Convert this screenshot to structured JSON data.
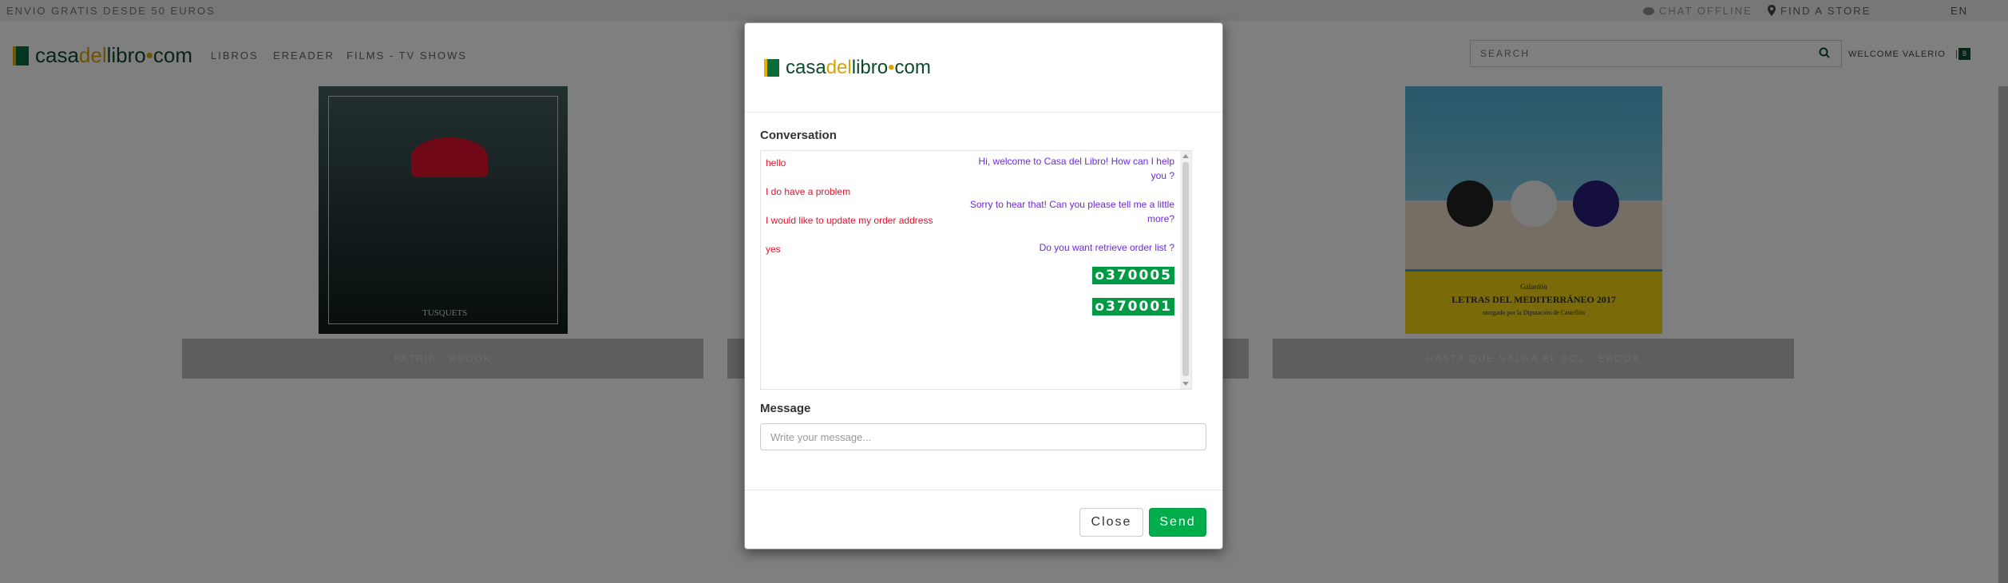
{
  "topbar": {
    "promo": "ENVIO GRATIS DESDE 50 EUROS",
    "chat_status": "CHAT OFFLINE",
    "find_store": "FIND A STORE",
    "language": "EN"
  },
  "header": {
    "logo": {
      "part1": "casa",
      "part2": "del",
      "part3": "libro",
      "part4": "•",
      "part5": "com"
    },
    "nav": [
      "LIBROS",
      "EREADER",
      "FILMS - TV SHOWS"
    ],
    "search_placeholder": "SEARCH",
    "welcome": "WELCOME VALERIO",
    "separator": "|",
    "cart_count": "8"
  },
  "books": [
    {
      "cover_brand": "TUSQUETS",
      "label": "PATRIA - EBOOK"
    },
    {
      "label": ""
    },
    {
      "cover_award": "Galardón",
      "cover_title": "LETRAS DEL MEDITERRÁNEO 2017",
      "cover_sub": "otorgado por la Diputación de Castellón",
      "label": "HASTA QUE SALGA EL SOL - EBOOK"
    }
  ],
  "modal": {
    "conversation_title": "Conversation",
    "messages": [
      {
        "from": "user",
        "text": "hello"
      },
      {
        "from": "bot",
        "text": "Hi, welcome to Casa del Libro! How can I help you ?"
      },
      {
        "from": "user",
        "text": "I do have a problem"
      },
      {
        "from": "bot",
        "text": "Sorry to hear that! Can you please tell me a little more?"
      },
      {
        "from": "user",
        "text": "I would like to update my order address"
      },
      {
        "from": "user",
        "text": "yes"
      },
      {
        "from": "bot",
        "text": "Do you want retrieve order list ?"
      },
      {
        "from": "bot",
        "text": "o370005"
      },
      {
        "from": "bot",
        "text": "o370001"
      }
    ],
    "message_title": "Message",
    "message_placeholder": "Write your message...",
    "close_label": "Close",
    "send_label": "Send"
  },
  "colors": {
    "brand_green": "#0c4a2b",
    "brand_yellow": "#d9a400",
    "user_text": "#e4122d",
    "bot_text": "#6b2bd6",
    "order_badge": "#009a44",
    "send_button": "#00ad4b"
  },
  "icons": [
    "chat-bubble-icon",
    "map-pin-icon",
    "search-icon",
    "book-logo-icon",
    "scroll-up-icon",
    "scroll-down-icon"
  ]
}
